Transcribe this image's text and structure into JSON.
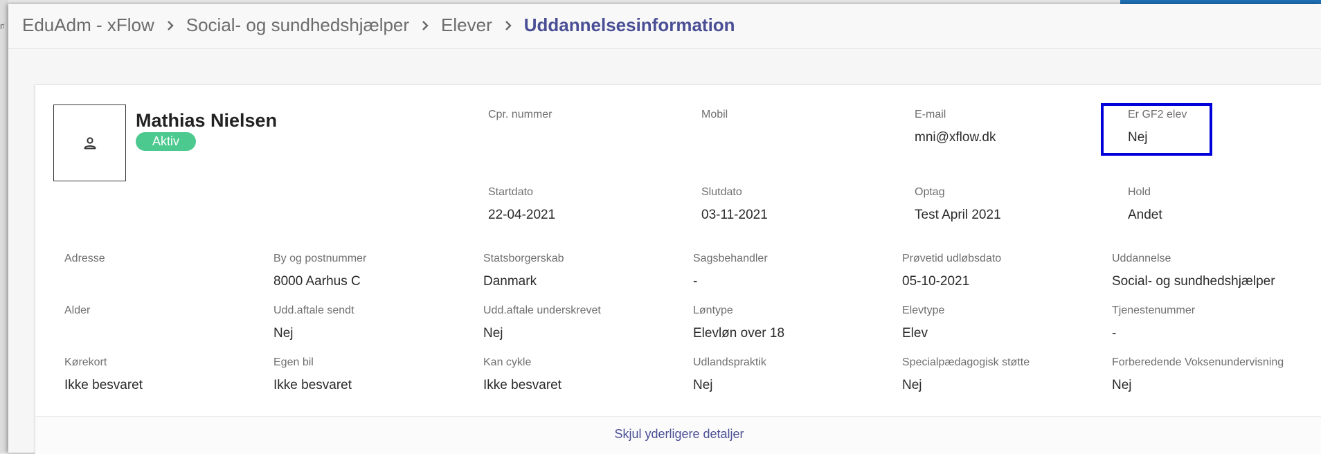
{
  "background": {
    "peek_text": "rt"
  },
  "breadcrumb": [
    "EduAdm - xFlow",
    "Social- og sundhedshjælper",
    "Elever",
    "Uddannelsesinformation"
  ],
  "student": {
    "name": "Mathias Nielsen",
    "status": "Aktiv",
    "avatar_icon": "person-outline-icon"
  },
  "fields": {
    "cpr": {
      "label": "Cpr. nummer",
      "value": ""
    },
    "mobil": {
      "label": "Mobil",
      "value": ""
    },
    "email": {
      "label": "E-mail",
      "value": "mni@xflow.dk"
    },
    "gf2": {
      "label": "Er GF2 elev",
      "value": "Nej"
    },
    "startdato": {
      "label": "Startdato",
      "value": "22-04-2021"
    },
    "slutdato": {
      "label": "Slutdato",
      "value": "03-11-2021"
    },
    "optag": {
      "label": "Optag",
      "value": "Test April 2021"
    },
    "hold": {
      "label": "Hold",
      "value": "Andet"
    },
    "adresse": {
      "label": "Adresse",
      "value": ""
    },
    "by": {
      "label": "By og postnummer",
      "value": "8000 Aarhus C"
    },
    "statsborgerskab": {
      "label": "Statsborgerskab",
      "value": "Danmark"
    },
    "sagsbehandler": {
      "label": "Sagsbehandler",
      "value": "-"
    },
    "proevetid": {
      "label": "Prøvetid udløbsdato",
      "value": "05-10-2021"
    },
    "uddannelse": {
      "label": "Uddannelse",
      "value": "Social- og sundhedshjælper"
    },
    "alder": {
      "label": "Alder",
      "value": ""
    },
    "udd_sendt": {
      "label": "Udd.aftale sendt",
      "value": "Nej"
    },
    "udd_underskrevet": {
      "label": "Udd.aftale underskrevet",
      "value": "Nej"
    },
    "loentype": {
      "label": "Løntype",
      "value": "Elevløn over 18"
    },
    "elevtype": {
      "label": "Elevtype",
      "value": "Elev"
    },
    "tjenestenummer": {
      "label": "Tjenestenummer",
      "value": "-"
    },
    "koerekort": {
      "label": "Kørekort",
      "value": "Ikke besvaret"
    },
    "egen_bil": {
      "label": "Egen bil",
      "value": "Ikke besvaret"
    },
    "kan_cykle": {
      "label": "Kan cykle",
      "value": "Ikke besvaret"
    },
    "udlandspraktik": {
      "label": "Udlandspraktik",
      "value": "Nej"
    },
    "specialpaed": {
      "label": "Specialpædagogisk støtte",
      "value": "Nej"
    },
    "fvu": {
      "label": "Forberedende Voksenundervisning",
      "value": "Nej"
    }
  },
  "toggle_details": "Skjul yderligere detaljer",
  "colors": {
    "accent": "#4a4f95",
    "status_active": "#4cc98f",
    "highlight": "#0000d8"
  }
}
